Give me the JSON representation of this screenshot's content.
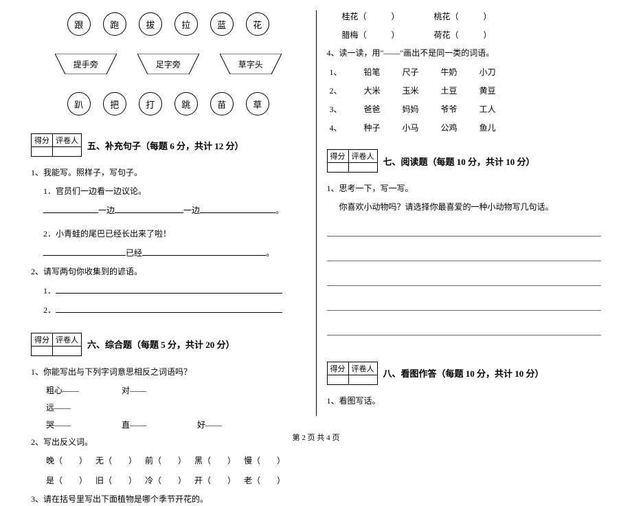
{
  "circles_top": [
    "跟",
    "跑",
    "拔",
    "拉",
    "蓝",
    "花"
  ],
  "trapezoids": [
    "提手旁",
    "足字旁",
    "草字头"
  ],
  "circles_bottom": [
    "趴",
    "把",
    "打",
    "跳",
    "苗",
    "草"
  ],
  "score_box": {
    "score_label": "得分",
    "scorer_label": "评卷人"
  },
  "sections": {
    "s5": {
      "title": "五、补充句子（每题 6 分，共计 12 分）"
    },
    "s6": {
      "title": "六、综合题（每题 5 分，共计 20 分）"
    },
    "s7": {
      "title": "七、阅读题（每题 10 分，共计 10 分）"
    },
    "s8": {
      "title": "八、看图作答（每题 10 分，共计 10 分）"
    }
  },
  "q5": {
    "q1": "1、我能写。照样子，写句子。",
    "q1_1": "1．官员们一边看一边议论。",
    "q1_fill": "一边",
    "q1_fill2": "一边",
    "q1_2": "2．小青蛙的尾巴已经长出来了啦！",
    "q1_2_fill": "已经",
    "q2": "2、请写两句你收集到的谚语。",
    "q2_1": "1．",
    "q2_2": "2．"
  },
  "q6": {
    "q1": "1、你能写出与下列字词意思相反之词语吗？",
    "pairs": [
      [
        "粗心——",
        "对——",
        ""
      ],
      [
        "远——",
        "",
        ""
      ],
      [
        "哭——",
        "直——",
        "好——"
      ]
    ],
    "q2": "2、写出反义词。",
    "rev1": [
      "晚（　　）",
      "无（　　）",
      "前（　　）",
      "黑（　　）",
      "慢（　　）"
    ],
    "rev2": [
      "是（　　）",
      "旧（　　）",
      "冷（　　）",
      "开（　　）",
      "老（　　）"
    ],
    "q3": "3、请在括号里写出下面植物是哪个季节开花的。"
  },
  "flowers": {
    "f1a": "桂花（　　　）",
    "f1b": "桃花（　　　）",
    "f2a": "腊梅（　　　）",
    "f2b": "荷花（　　　）"
  },
  "q6_4": {
    "title": "4、读一读，用\"——\"画出不是同一类的词语。",
    "rows": [
      {
        "idx": "1、",
        "words": [
          "铅笔",
          "尺子",
          "牛奶",
          "小刀"
        ]
      },
      {
        "idx": "2、",
        "words": [
          "大米",
          "玉米",
          "土豆",
          "黄豆"
        ]
      },
      {
        "idx": "3、",
        "words": [
          "爸爸",
          "妈妈",
          "爷爷",
          "工人"
        ]
      },
      {
        "idx": "4、",
        "words": [
          "种子",
          "小马",
          "公鸡",
          "鱼儿"
        ]
      }
    ]
  },
  "q7": {
    "q1": "1、思考一下，写一写。",
    "q1_sub": "你喜欢小动物吗？请选择你最喜爱的一种小动物写几句话。"
  },
  "q8": {
    "q1": "1、看图写话。"
  },
  "footer": "第 2 页 共 4 页"
}
